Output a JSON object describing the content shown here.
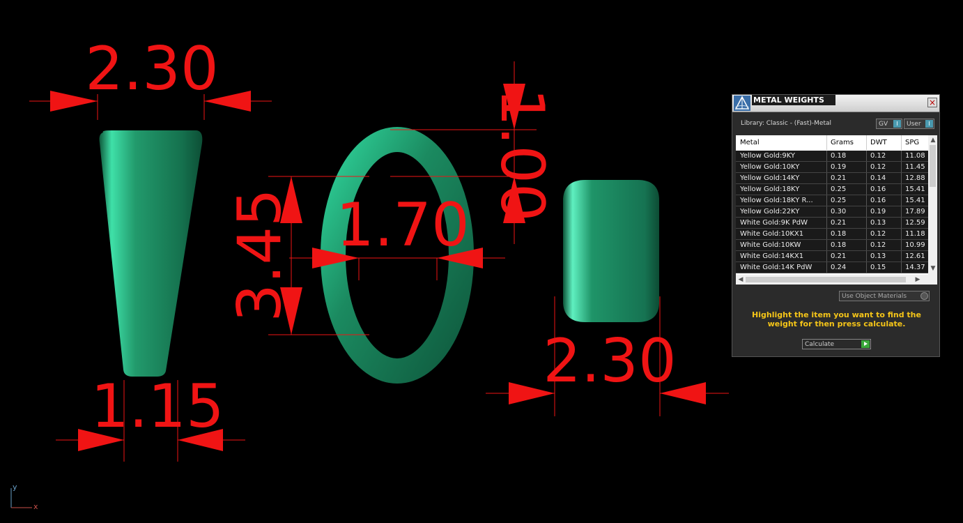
{
  "dimensions": {
    "top_left": "2.30",
    "bottom_left": "1.15",
    "height_middle": "3.45",
    "inner_middle": "1.70",
    "thickness_top": "1.00",
    "right_width": "2.30"
  },
  "panel": {
    "title": "METAL WEIGHTS",
    "close_glyph": "×",
    "library_label": "Library: Classic - (Fast)-Metal",
    "gv_label": "GV",
    "user_label": "User",
    "indicator": "I",
    "columns": [
      "Metal",
      "Grams",
      "DWT",
      "SPG"
    ],
    "rows": [
      [
        "Yellow Gold:9KY",
        "0.18",
        "0.12",
        "11.08"
      ],
      [
        "Yellow Gold:10KY",
        "0.19",
        "0.12",
        "11.45"
      ],
      [
        "Yellow Gold:14KY",
        "0.21",
        "0.14",
        "12.88"
      ],
      [
        "Yellow Gold:18KY",
        "0.25",
        "0.16",
        "15.41"
      ],
      [
        "Yellow Gold:18KY R...",
        "0.25",
        "0.16",
        "15.41"
      ],
      [
        "Yellow Gold:22KY",
        "0.30",
        "0.19",
        "17.89"
      ],
      [
        "White Gold:9K PdW",
        "0.21",
        "0.13",
        "12.59"
      ],
      [
        "White Gold:10KX1",
        "0.18",
        "0.12",
        "11.18"
      ],
      [
        "White Gold:10KW",
        "0.18",
        "0.12",
        "10.99"
      ],
      [
        "White Gold:14KX1",
        "0.21",
        "0.13",
        "12.61"
      ],
      [
        "White Gold:14K PdW",
        "0.24",
        "0.15",
        "14.37"
      ]
    ],
    "use_object_materials": "Use Object Materials",
    "hint": "Highlight the item you want to find the weight for then press calculate.",
    "calculate_label": "Calculate"
  },
  "axis": {
    "y": "y",
    "x": "x"
  },
  "colors": {
    "dimension": "#f01414",
    "model": "#1f8a60",
    "hint": "#f5c518"
  }
}
